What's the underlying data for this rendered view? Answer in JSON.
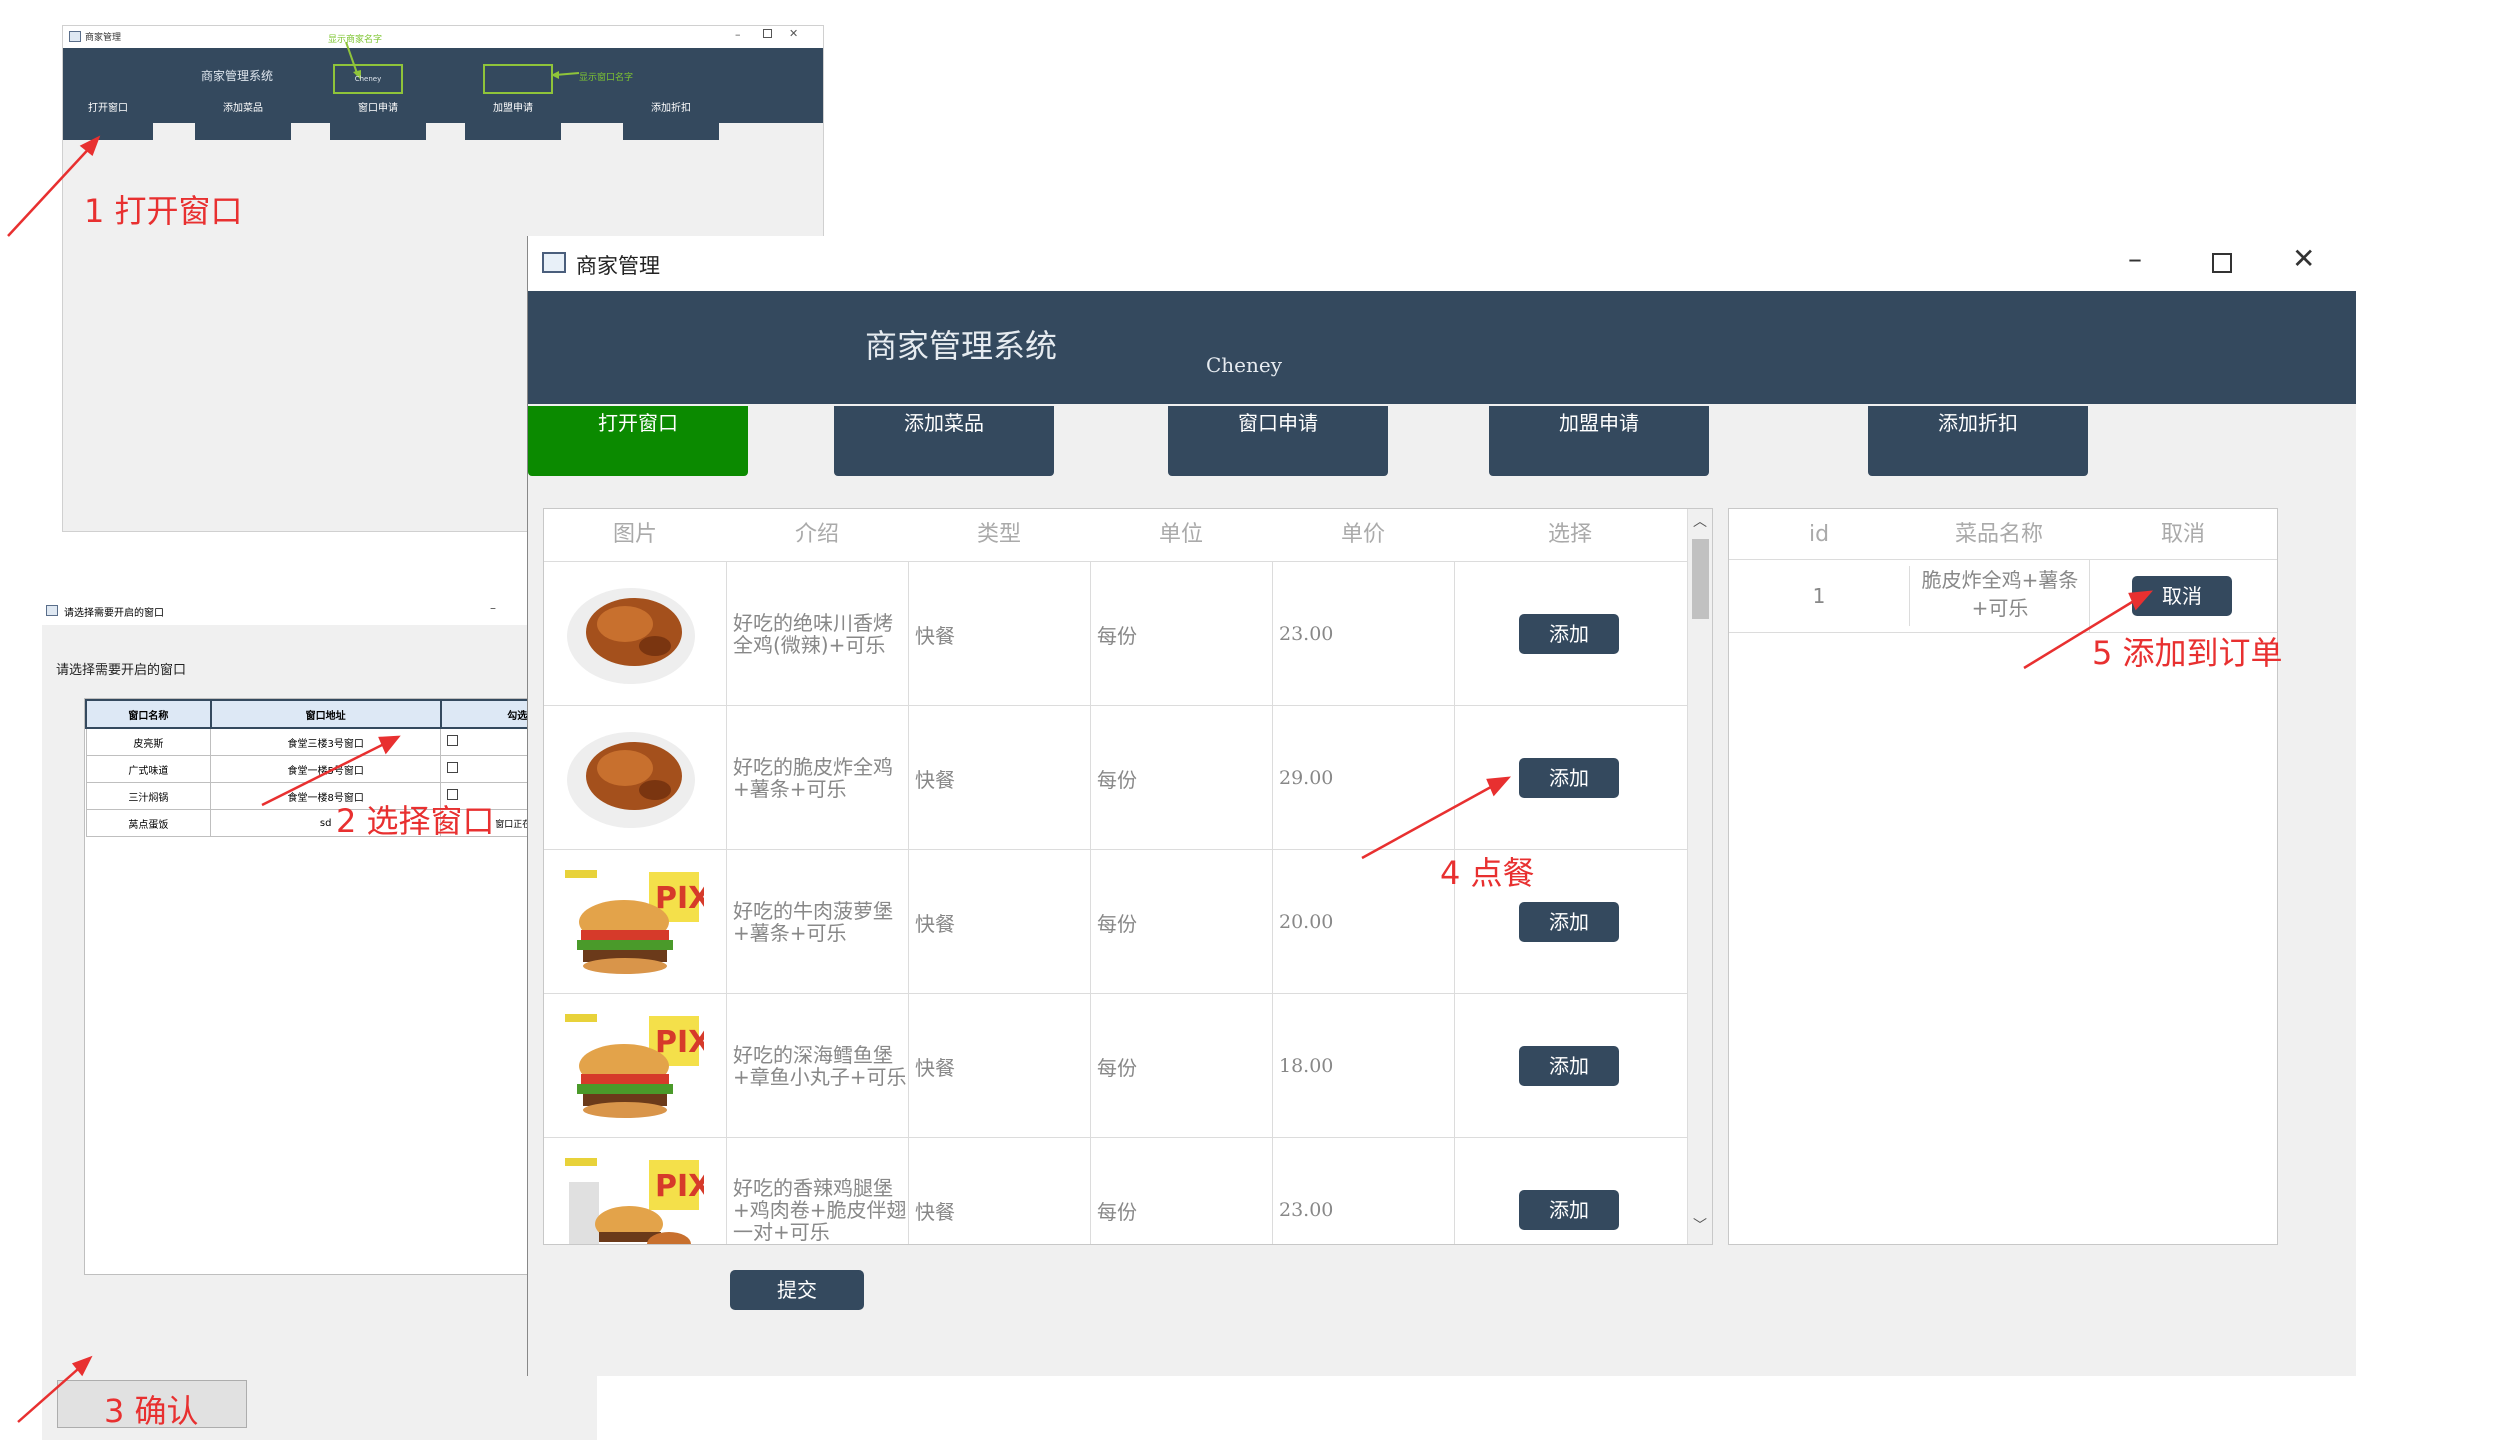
{
  "bg_window1": {
    "title": "商家管理",
    "header_title": "商家管理系统",
    "user": "Cheney",
    "note_top": "显示商家名字",
    "note_right": "显示窗口名字",
    "buttons": [
      "打开窗口",
      "添加菜品",
      "窗口申请",
      "加盟申请",
      "添加折扣"
    ]
  },
  "bg_window2": {
    "title": "请选择需要开启的窗口",
    "prompt": "请选择需要开启的窗口",
    "columns": [
      "窗口名称",
      "窗口地址",
      "勾选框"
    ],
    "rows": [
      {
        "name": "皮亮斯",
        "addr": "食堂三楼3号窗口"
      },
      {
        "name": "广式味道",
        "addr": "食堂一楼5号窗口"
      },
      {
        "name": "三汁焖锅",
        "addr": "食堂一楼8号窗口"
      },
      {
        "name": "莴点蛋饭",
        "addr": "sd",
        "extra": "窗口正在审核"
      }
    ]
  },
  "main": {
    "title": "商家管理",
    "header_title": "商家管理系统",
    "user": "Cheney",
    "nav": [
      "打开窗口",
      "添加菜品",
      "窗口申请",
      "加盟申请",
      "添加折扣"
    ],
    "menu_columns": [
      "图片",
      "介绍",
      "类型",
      "单位",
      "单价",
      "选择"
    ],
    "menu_rows": [
      {
        "desc": "好吃的绝味川香烤全鸡(微辣)+可乐",
        "type": "快餐",
        "unit": "每份",
        "price": "23.00",
        "btn": "添加",
        "img": "chicken"
      },
      {
        "desc": "好吃的脆皮炸全鸡+薯条+可乐",
        "type": "快餐",
        "unit": "每份",
        "price": "29.00",
        "btn": "添加",
        "img": "chicken"
      },
      {
        "desc": "好吃的牛肉菠萝堡+薯条+可乐",
        "type": "快餐",
        "unit": "每份",
        "price": "20.00",
        "btn": "添加",
        "img": "burger"
      },
      {
        "desc": "好吃的深海鳕鱼堡+章鱼小丸子+可乐",
        "type": "快餐",
        "unit": "每份",
        "price": "18.00",
        "btn": "添加",
        "img": "burger"
      },
      {
        "desc": "好吃的香辣鸡腿堡+鸡肉卷+脆皮伴翅一对+可乐",
        "type": "快餐",
        "unit": "每份",
        "price": "23.00",
        "btn": "添加",
        "img": "combo"
      }
    ],
    "order_columns": [
      "id",
      "菜品名称",
      "取消"
    ],
    "order_rows": [
      {
        "id": "1",
        "name": "脆皮炸全鸡+薯条+可乐",
        "btn": "取消"
      }
    ],
    "submit": "提交"
  },
  "annotations": {
    "a1": "1 打开窗口",
    "a2": "2 选择窗口",
    "a3": "3 确认",
    "a4": "4 点餐",
    "a5": "5 添加到订单"
  },
  "colors": {
    "header": "#34495e",
    "active": "#0b8a00",
    "annotation": "#e83030"
  }
}
